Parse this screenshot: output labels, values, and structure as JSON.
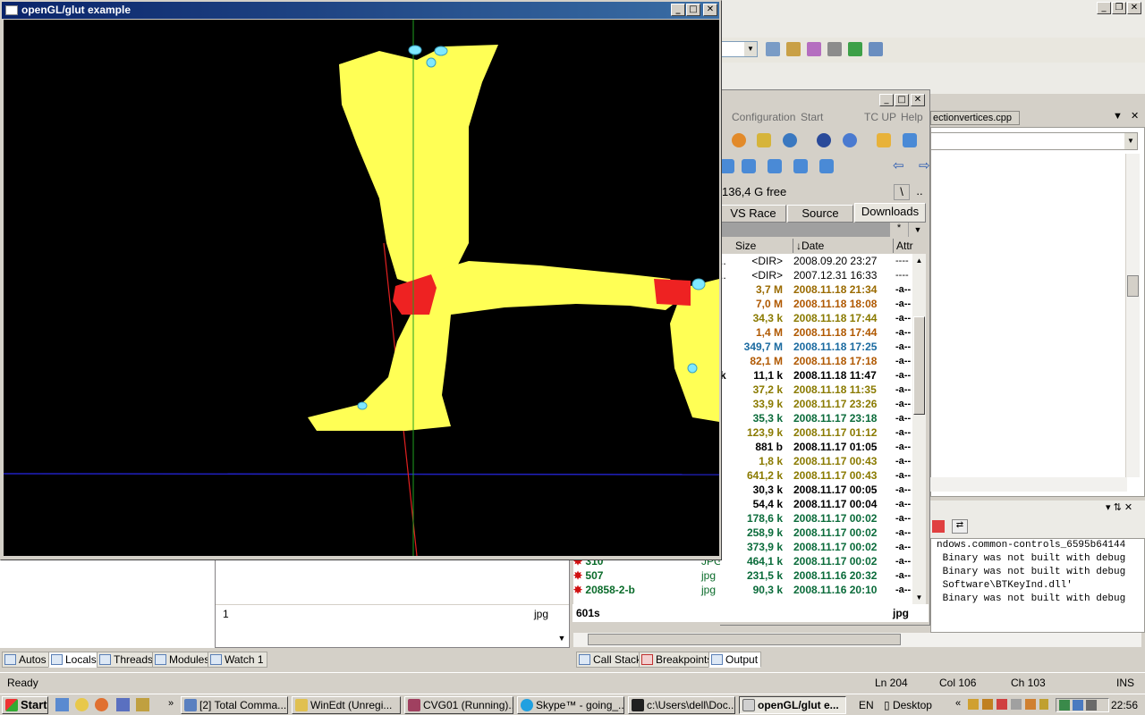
{
  "gl_window": {
    "title": "openGL/glut example"
  },
  "tc": {
    "menu": [
      "Configuration",
      "Start",
      "TC UP",
      "Help"
    ],
    "drive_free": "136,4 G free",
    "drive_root": "\\",
    "drive_up": "..",
    "tabs": [
      "VS Race Eng",
      "Source",
      "Downloads"
    ],
    "columns": {
      "size": "Size",
      "date": "↓Date",
      "attr": "Attr"
    },
    "rows": [
      {
        "mark": "..",
        "size": "<DIR>",
        "date": "2008.09.20 23:27",
        "attr": "----",
        "color": "#000000"
      },
      {
        "mark": "..",
        "size": "<DIR>",
        "date": "2007.12.31 16:33",
        "attr": "----",
        "color": "#000000"
      },
      {
        "mark": "",
        "size": "3,7 M",
        "date": "2008.11.18 21:34",
        "attr": "-a--",
        "color": "#9a6a00"
      },
      {
        "mark": "",
        "size": "7,0 M",
        "date": "2008.11.18 18:08",
        "attr": "-a--",
        "color": "#b05800"
      },
      {
        "mark": "",
        "size": "34,3 k",
        "date": "2008.11.18 17:44",
        "attr": "-a--",
        "color": "#8a7a00"
      },
      {
        "mark": "",
        "size": "1,4 M",
        "date": "2008.11.18 17:44",
        "attr": "-a--",
        "color": "#b05800"
      },
      {
        "mark": "",
        "size": "349,7 M",
        "date": "2008.11.18 17:25",
        "attr": "-a--",
        "color": "#1a6aa0"
      },
      {
        "mark": "",
        "size": "82,1 M",
        "date": "2008.11.18 17:18",
        "attr": "-a--",
        "color": "#b05800"
      },
      {
        "mark": "k",
        "size": "11,1 k",
        "date": "2008.11.18 11:47",
        "attr": "-a--",
        "color": "#000000"
      },
      {
        "mark": "",
        "size": "37,2 k",
        "date": "2008.11.18 11:35",
        "attr": "-a--",
        "color": "#8a7a00"
      },
      {
        "mark": "",
        "size": "33,9 k",
        "date": "2008.11.17 23:26",
        "attr": "-a--",
        "color": "#8a7a00"
      },
      {
        "mark": "",
        "size": "35,3 k",
        "date": "2008.11.17 23:18",
        "attr": "-a--",
        "color": "#0a6b3a"
      },
      {
        "mark": "",
        "size": "123,9 k",
        "date": "2008.11.17 01:12",
        "attr": "-a--",
        "color": "#8a7a00"
      },
      {
        "mark": "",
        "size": "881 b",
        "date": "2008.11.17 01:05",
        "attr": "-a--",
        "color": "#000000"
      },
      {
        "mark": "",
        "size": "1,8 k",
        "date": "2008.11.17 00:43",
        "attr": "-a--",
        "color": "#8a7a00"
      },
      {
        "mark": "",
        "size": "641,2 k",
        "date": "2008.11.17 00:43",
        "attr": "-a--",
        "color": "#8a7a00"
      },
      {
        "mark": "",
        "size": "30,3 k",
        "date": "2008.11.17 00:05",
        "attr": "-a--",
        "color": "#000000"
      },
      {
        "mark": "",
        "size": "54,4 k",
        "date": "2008.11.17 00:04",
        "attr": "-a--",
        "color": "#000000"
      },
      {
        "mark": "",
        "size": "178,6 k",
        "date": "2008.11.17 00:02",
        "attr": "-a--",
        "color": "#0a6b3a"
      },
      {
        "mark": "",
        "size": "258,9 k",
        "date": "2008.11.17 00:02",
        "attr": "-a--",
        "color": "#0a6b3a"
      },
      {
        "mark": "",
        "size": "373,9 k",
        "date": "2008.11.17 00:02",
        "attr": "-a--",
        "color": "#0a6b3a"
      },
      {
        "mark": "",
        "size": "464,1 k",
        "date": "2008.11.17 00:02",
        "attr": "-a--",
        "color": "#0a6b3a"
      },
      {
        "mark": "",
        "size": "231,5 k",
        "date": "2008.11.16 20:32",
        "attr": "-a--",
        "color": "#0a6b3a"
      },
      {
        "mark": "",
        "size": "90,3 k",
        "date": "2008.11.16 20:10",
        "attr": "-a--",
        "color": "#0a6b3a"
      }
    ],
    "left_rows": [
      {
        "name": "310",
        "ext": "JPG"
      },
      {
        "name": "507",
        "ext": "jpg"
      },
      {
        "name": "20858-2-b",
        "ext": "jpg"
      }
    ],
    "status_left": "601s",
    "status_right": "jpg"
  },
  "ide": {
    "doc_tab": "ectionvertices.cpp",
    "output_lines": [
      "ndows.common-controls_6595b64144",
      " Binary was not built with debug",
      " Binary was not built with debug",
      "",
      " Software\\BTKeyInd.dll'",
      " Binary was not built with debug"
    ],
    "left_lower_status": "1",
    "left_lower_ext": "jpg",
    "debug_tabs_left": [
      "Autos",
      "Locals",
      "Threads",
      "Modules",
      "Watch 1"
    ],
    "debug_tabs_right": [
      "Call Stack",
      "Breakpoints",
      "Output"
    ],
    "status": {
      "ready": "Ready",
      "ln": "Ln 204",
      "col": "Col 106",
      "ch": "Ch 103",
      "ins": "INS"
    }
  },
  "taskbar": {
    "start": "Start",
    "tasks": [
      "[2] Total Comma...",
      "WinEdt (Unregi...",
      "CVG01 (Running)...",
      "Skype™ - going_...",
      "c:\\Users\\dell\\Doc...",
      "openGL/glut e..."
    ],
    "lang": "EN",
    "desktop": "Desktop",
    "clock": "22:56"
  }
}
